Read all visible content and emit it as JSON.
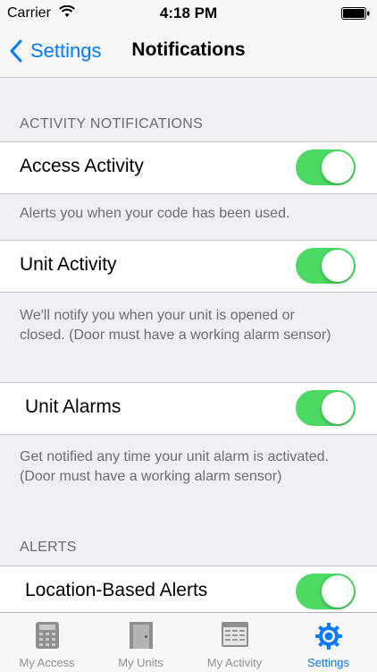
{
  "status_bar": {
    "carrier": "Carrier",
    "time": "4:18 PM"
  },
  "nav": {
    "back_label": "Settings",
    "title": "Notifications"
  },
  "sections": {
    "activity_header": "ACTIVITY NOTIFICATIONS",
    "alerts_header": "ALERTS"
  },
  "rows": {
    "access_activity": {
      "label": "Access Activity",
      "enabled": true,
      "footer": "Alerts you when your code has been used."
    },
    "unit_activity": {
      "label": "Unit Activity",
      "enabled": true,
      "footer": "We'll notify you when your unit is opened or closed. (Door must have a working alarm sensor)"
    },
    "unit_alarms": {
      "label": "Unit Alarms",
      "enabled": true,
      "footer": "Get notified any time your unit alarm is activated. (Door must have a working alarm sensor)"
    },
    "location_alerts": {
      "label": "Location-Based Alerts",
      "enabled": true
    }
  },
  "tabbar": {
    "tabs": [
      {
        "label": "My Access",
        "icon": "keypad-icon"
      },
      {
        "label": "My Units",
        "icon": "door-icon"
      },
      {
        "label": "My Activity",
        "icon": "calendar-icon"
      },
      {
        "label": "Settings",
        "icon": "gear-icon",
        "active": true
      }
    ]
  },
  "colors": {
    "accent": "#007aff",
    "toggle_on": "#4cd964",
    "background": "#efeff4"
  }
}
